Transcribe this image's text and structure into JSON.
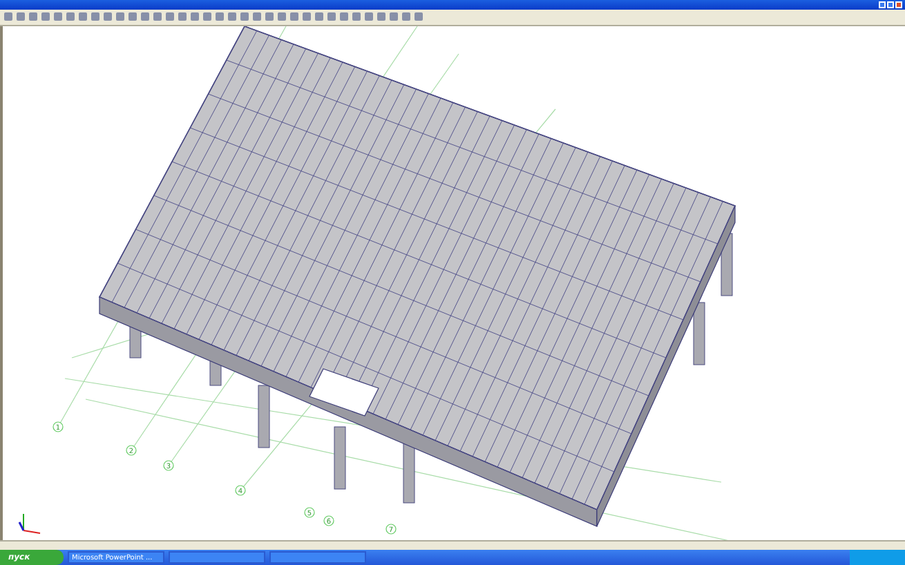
{
  "canvas": {
    "grid_labels": [
      "1",
      "2",
      "3",
      "4",
      "5",
      "6",
      "7"
    ]
  },
  "taskbar": {
    "start": "пуск",
    "tasks": [
      {
        "label": "Microsoft PowerPoint ...",
        "selected": false
      }
    ]
  }
}
